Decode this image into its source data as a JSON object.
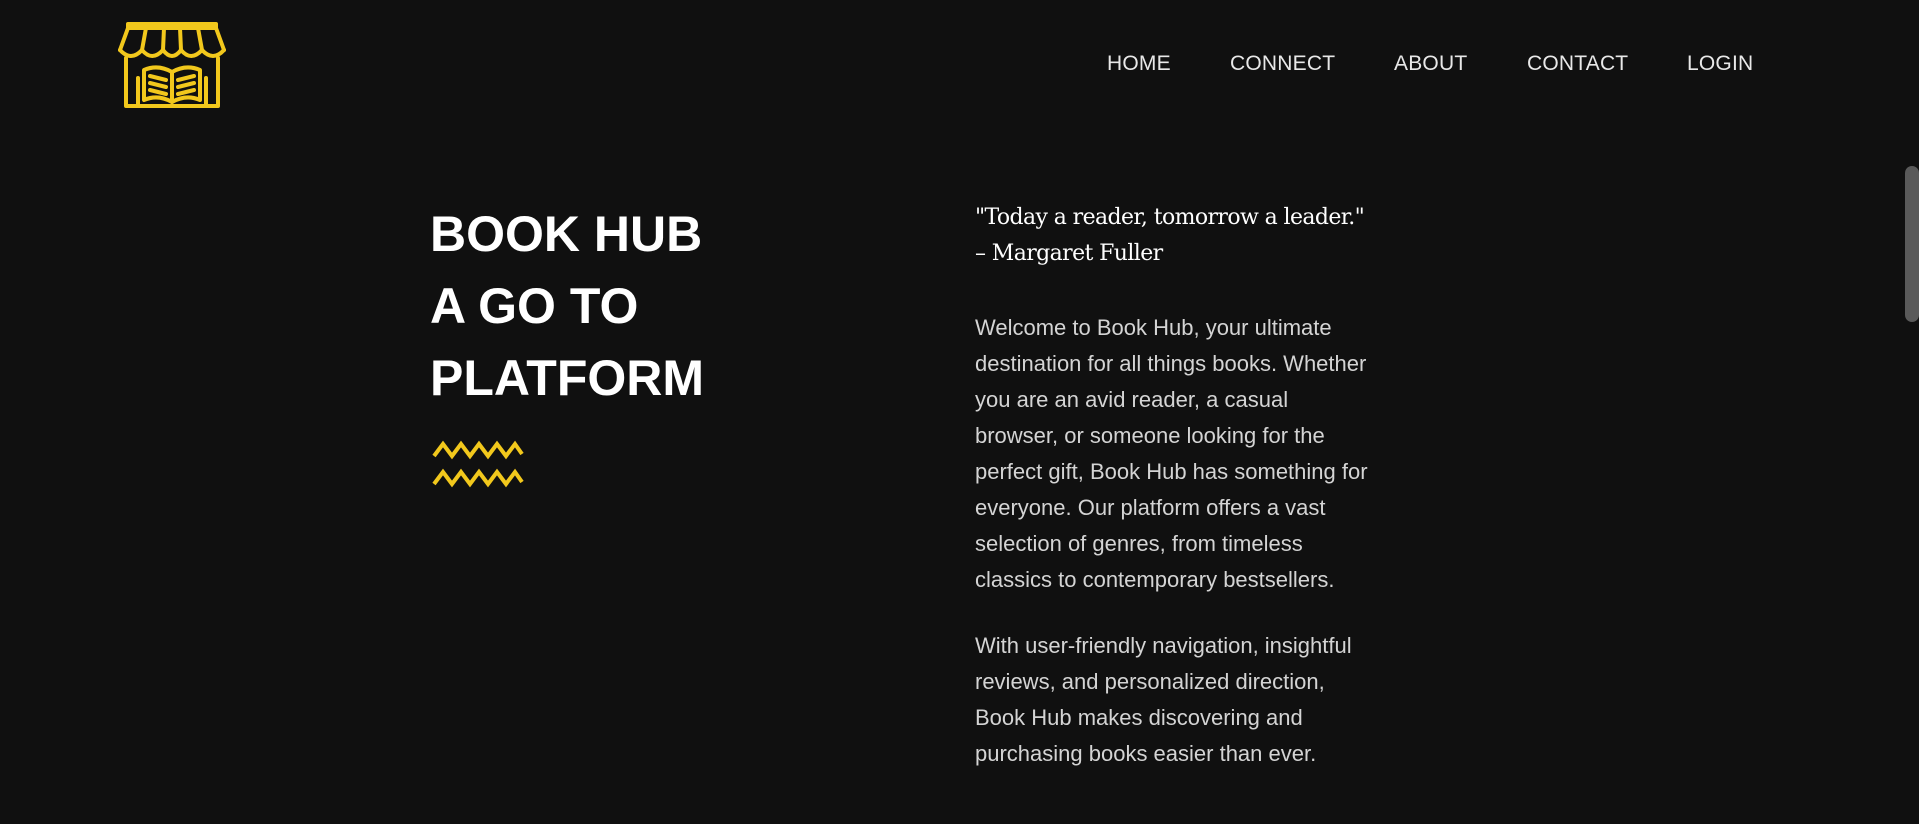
{
  "brand": {
    "logo_icon": "bookstore-logo-icon",
    "accent_color": "#f2c81c"
  },
  "nav": {
    "items": [
      "HOME",
      "CONNECT",
      "ABOUT",
      "CONTACT",
      "LOGIN"
    ]
  },
  "hero": {
    "title_lines": [
      "BOOK HUB",
      "A GO TO",
      "PLATFORM"
    ],
    "decoration_icon": "zigzag-icon"
  },
  "content": {
    "quote_lines": [
      "\"Today a reader, tomorrow a leader.\"",
      "– Margaret Fuller"
    ],
    "paragraphs": [
      "Welcome to Book Hub, your ultimate destination for all things books. Whether you are an avid reader, a casual browser, or someone looking for the perfect gift, Book Hub has something for everyone. Our platform offers a vast selection of genres, from timeless classics to contemporary bestsellers.",
      "With user-friendly navigation, insightful reviews, and personalized direction, Book Hub makes discovering and purchasing books easier than ever."
    ]
  },
  "colors": {
    "background": "#101010",
    "text_primary": "#ffffff",
    "text_secondary": "#d4d4d4"
  }
}
